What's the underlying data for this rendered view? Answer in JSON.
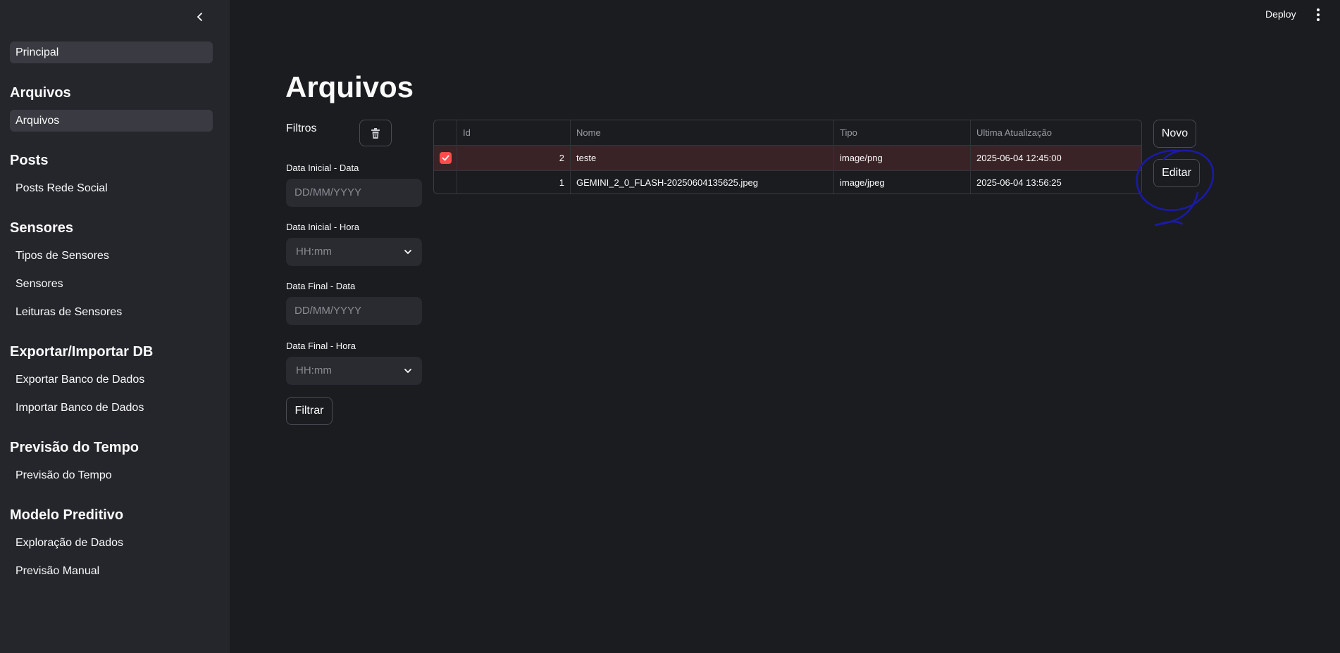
{
  "sidebar": {
    "home": "Principal",
    "sections": [
      {
        "title": "Arquivos",
        "items": [
          "Arquivos"
        ]
      },
      {
        "title": "Posts",
        "items": [
          "Posts Rede Social"
        ]
      },
      {
        "title": "Sensores",
        "items": [
          "Tipos de Sensores",
          "Sensores",
          "Leituras de Sensores"
        ]
      },
      {
        "title": "Exportar/Importar DB",
        "items": [
          "Exportar Banco de Dados",
          "Importar Banco de Dados"
        ]
      },
      {
        "title": "Previsão do Tempo",
        "items": [
          "Previsão do Tempo"
        ]
      },
      {
        "title": "Modelo Preditivo",
        "items": [
          "Exploração de Dados",
          "Previsão Manual"
        ]
      }
    ],
    "active_item": "Arquivos"
  },
  "header": {
    "deploy_label": "Deploy"
  },
  "main": {
    "title": "Arquivos",
    "filters": {
      "label": "Filtros",
      "data_inicial_data_label": "Data Inicial - Data",
      "data_inicial_data_placeholder": "DD/MM/YYYY",
      "data_inicial_hora_label": "Data Inicial - Hora",
      "data_inicial_hora_placeholder": "HH:mm",
      "data_final_data_label": "Data Final - Data",
      "data_final_data_placeholder": "DD/MM/YYYY",
      "data_final_hora_label": "Data Final - Hora",
      "data_final_hora_placeholder": "HH:mm",
      "filter_button": "Filtrar"
    },
    "table": {
      "columns": [
        "Id",
        "Nome",
        "Tipo",
        "Ultima Atualização"
      ],
      "rows": [
        {
          "selected": true,
          "id": "2",
          "nome": "teste",
          "tipo": "image/png",
          "atualizacao": "2025-06-04 12:45:00"
        },
        {
          "selected": false,
          "id": "1",
          "nome": "GEMINI_2_0_FLASH-20250604135625.jpeg",
          "tipo": "image/jpeg",
          "atualizacao": "2025-06-04 13:56:25"
        }
      ]
    },
    "actions": {
      "novo": "Novo",
      "editar": "Editar"
    }
  },
  "colors": {
    "accent": "#ff4b4b",
    "annotation": "#1a1aa8",
    "background": "#1b1c20",
    "sidebar": "#25262c"
  },
  "icons": [
    "chevron-left-icon",
    "more-vertical-icon",
    "trash-icon",
    "chevron-down-icon",
    "check-icon"
  ]
}
